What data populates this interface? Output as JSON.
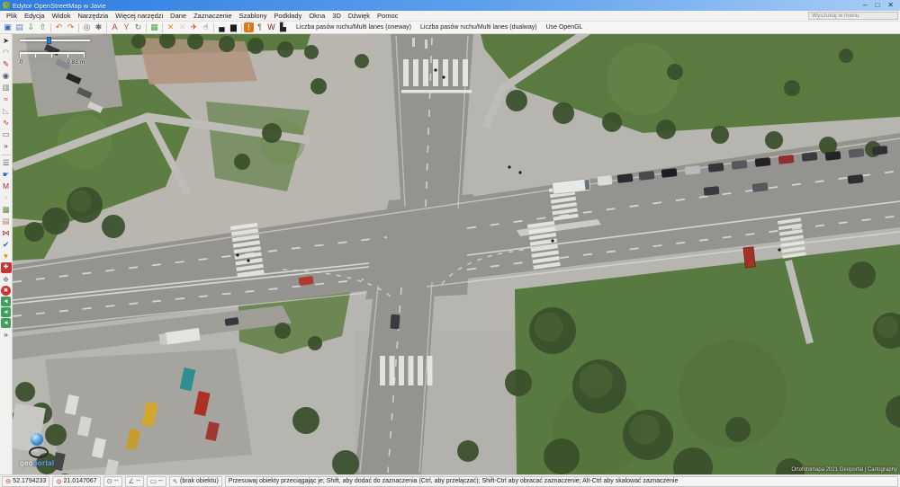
{
  "window": {
    "title": "Edytor OpenStreetMap w Javie",
    "minimize": "–",
    "maximize": "□",
    "close": "✕"
  },
  "menu": {
    "items": [
      "Plik",
      "Edycja",
      "Widok",
      "Narzędzia",
      "Więcej narzędzi",
      "Dane",
      "Zaznaczenie",
      "Szablony",
      "Podkłady",
      "Okna",
      "3D",
      "Dźwięk",
      "Pomoc"
    ],
    "search_placeholder": "Wyszukaj w menu"
  },
  "toolbar": {
    "items": [
      {
        "name": "open-file-button",
        "glyph": "▣",
        "color": "#2f6fbe"
      },
      {
        "name": "save-file-button",
        "glyph": "▤",
        "color": "#5b87c5"
      },
      {
        "name": "download-data-button",
        "glyph": "⇩",
        "color": "#3f8f3f"
      },
      {
        "name": "upload-data-button",
        "glyph": "⇧",
        "color": "#3f8f3f"
      },
      {
        "name": "toolbar-separator",
        "cls": "sep"
      },
      {
        "name": "undo-button",
        "glyph": "↶",
        "color": "#d07020"
      },
      {
        "name": "redo-button",
        "glyph": "↷",
        "color": "#d07020"
      },
      {
        "name": "toolbar-separator",
        "cls": "sep"
      },
      {
        "name": "zoom-to-selection-button",
        "glyph": "◎",
        "color": "#6a6a6a"
      },
      {
        "name": "preferences-button",
        "glyph": "✱",
        "color": "#6a6a6a"
      },
      {
        "name": "toolbar-separator",
        "cls": "sep"
      },
      {
        "name": "map-styles-button",
        "glyph": "A",
        "color": "#b04030"
      },
      {
        "name": "presets-button",
        "glyph": "Y",
        "color": "#8a6d3b"
      },
      {
        "name": "refresh-button",
        "glyph": "↻",
        "color": "#4a8f4a"
      },
      {
        "name": "toolbar-separator",
        "cls": "sep"
      },
      {
        "name": "plugins-button",
        "glyph": "▦",
        "color": "#4a9f4a"
      },
      {
        "name": "toolbar-separator",
        "cls": "sep"
      },
      {
        "name": "merge-tool-button",
        "glyph": "✕",
        "color": "#e08a20"
      },
      {
        "name": "unglue-tool-button",
        "glyph": "✕",
        "color": "#d0d0d0"
      },
      {
        "name": "combine-tool-button",
        "glyph": "✈",
        "color": "#c55a20"
      },
      {
        "name": "pan-hand-button",
        "glyph": "☝",
        "color": "#1a1a1a"
      },
      {
        "name": "toolbar-separator",
        "cls": "sep"
      },
      {
        "name": "car-icon-button",
        "glyph": "▄",
        "color": "#1a1a1a"
      },
      {
        "name": "bus-icon-button",
        "glyph": "▆",
        "color": "#1a1a1a"
      },
      {
        "name": "toolbar-separator",
        "cls": "sep"
      },
      {
        "name": "warning-door-button",
        "glyph": "!",
        "color": "#ffffff",
        "cls": "orange-bg"
      },
      {
        "name": "restaurant-button",
        "glyph": "¶",
        "color": "#8a6d3b"
      },
      {
        "name": "tat-logo-button",
        "glyph": "W",
        "color": "#7a1f1f"
      },
      {
        "name": "factory-button",
        "glyph": "▙",
        "color": "#222222"
      }
    ],
    "text_buttons": [
      {
        "name": "multi-lanes-oneway-button",
        "label": "Liczba pasów ruchu/Multi lanes (oneway)"
      },
      {
        "name": "multi-lanes-dualway-button",
        "label": "Liczba pasów ruchu/Multi lanes (dualway)"
      },
      {
        "name": "use-opengl-button",
        "label": "Use OpenGL"
      }
    ]
  },
  "sidebar": {
    "tools": [
      {
        "name": "select-tool",
        "glyph": "➤",
        "color": "#333333"
      },
      {
        "name": "lasso-tool",
        "glyph": "◠",
        "color": "#8a8a8a"
      },
      {
        "name": "draw-node-tool",
        "glyph": "✎",
        "color": "#b03030"
      },
      {
        "name": "zoom-tool",
        "glyph": "◉",
        "color": "#555566"
      },
      {
        "name": "delete-tool",
        "glyph": "▥",
        "color": "#777777"
      },
      {
        "name": "parallel-way-tool",
        "glyph": "≈",
        "color": "#b03030"
      },
      {
        "name": "extrude-tool",
        "glyph": "◺",
        "color": "#999999"
      },
      {
        "name": "improve-way-tool",
        "glyph": "∿",
        "color": "#b03030"
      },
      {
        "name": "building-tool",
        "glyph": "▭",
        "color": "#666666"
      },
      {
        "name": "more-tools-button",
        "glyph": "»",
        "color": "#333333"
      },
      {
        "name": "sidebar-separator",
        "cls": "hsep"
      },
      {
        "name": "layers-panel-toggle",
        "glyph": "☰",
        "color": "#556677"
      },
      {
        "name": "pointer-panel-toggle",
        "glyph": "☛",
        "color": "#2a6fd0"
      },
      {
        "name": "mapillary-toggle",
        "glyph": "M",
        "color": "#b03030"
      },
      {
        "name": "selection-panel-toggle",
        "glyph": "▫",
        "color": "#999999"
      },
      {
        "name": "photo-panel-toggle",
        "glyph": "▩",
        "color": "#5a8f4a"
      },
      {
        "name": "clipboard-panel-toggle",
        "glyph": "▤",
        "color": "#aa8877"
      },
      {
        "name": "mapdust-toggle",
        "glyph": "⋈",
        "color": "#b03030"
      },
      {
        "name": "validator-toggle",
        "glyph": "✔",
        "color": "#2255cc"
      },
      {
        "name": "filter-toggle",
        "glyph": "▼",
        "color": "#c9a227"
      },
      {
        "name": "toolbox-toggle",
        "glyph": "✚",
        "color": "#ffffff",
        "cls": "red-box"
      },
      {
        "name": "plugin-panel-toggle",
        "glyph": "❖",
        "color": "#888888"
      },
      {
        "name": "notes-toggle",
        "glyph": "✖",
        "color": "#ffffff",
        "cls": "red-pin"
      },
      {
        "name": "turn-restriction-tool-1",
        "glyph": "◄",
        "color": "#ffffff",
        "cls": "green-box"
      },
      {
        "name": "turn-restriction-tool-2",
        "glyph": "◄",
        "color": "#ffffff",
        "cls": "green-box"
      },
      {
        "name": "turn-restriction-tool-3",
        "glyph": "◄",
        "color": "#ffffff",
        "cls": "green-box"
      },
      {
        "name": "more-panels-button",
        "glyph": "»",
        "color": "#333333"
      }
    ]
  },
  "map": {
    "scale_start": "0",
    "scale_end": "9.83 m",
    "watermark_geo": "geo",
    "watermark_portal": "portal",
    "attribution": "Ortofotomapa 2021 Geoportal | Cartography",
    "colors": {
      "grass": "#5a7a40",
      "road": "#94938f",
      "pavement": "#b6b5af",
      "zebra": "#eceae4"
    }
  },
  "statusbar": {
    "lat": "52.1794233",
    "lon": "21.0147067",
    "heading": "--",
    "angle": "--",
    "distance": "--",
    "object_label": "(brak obiektu)",
    "help": "Przesuwaj obiekty przeciągając je; Shift, aby dodać do zaznaczenia (Ctrl, aby przełączać); Shift-Ctrl aby obracać zaznaczenie; Alt-Ctrl aby skalować zaznaczenie"
  }
}
